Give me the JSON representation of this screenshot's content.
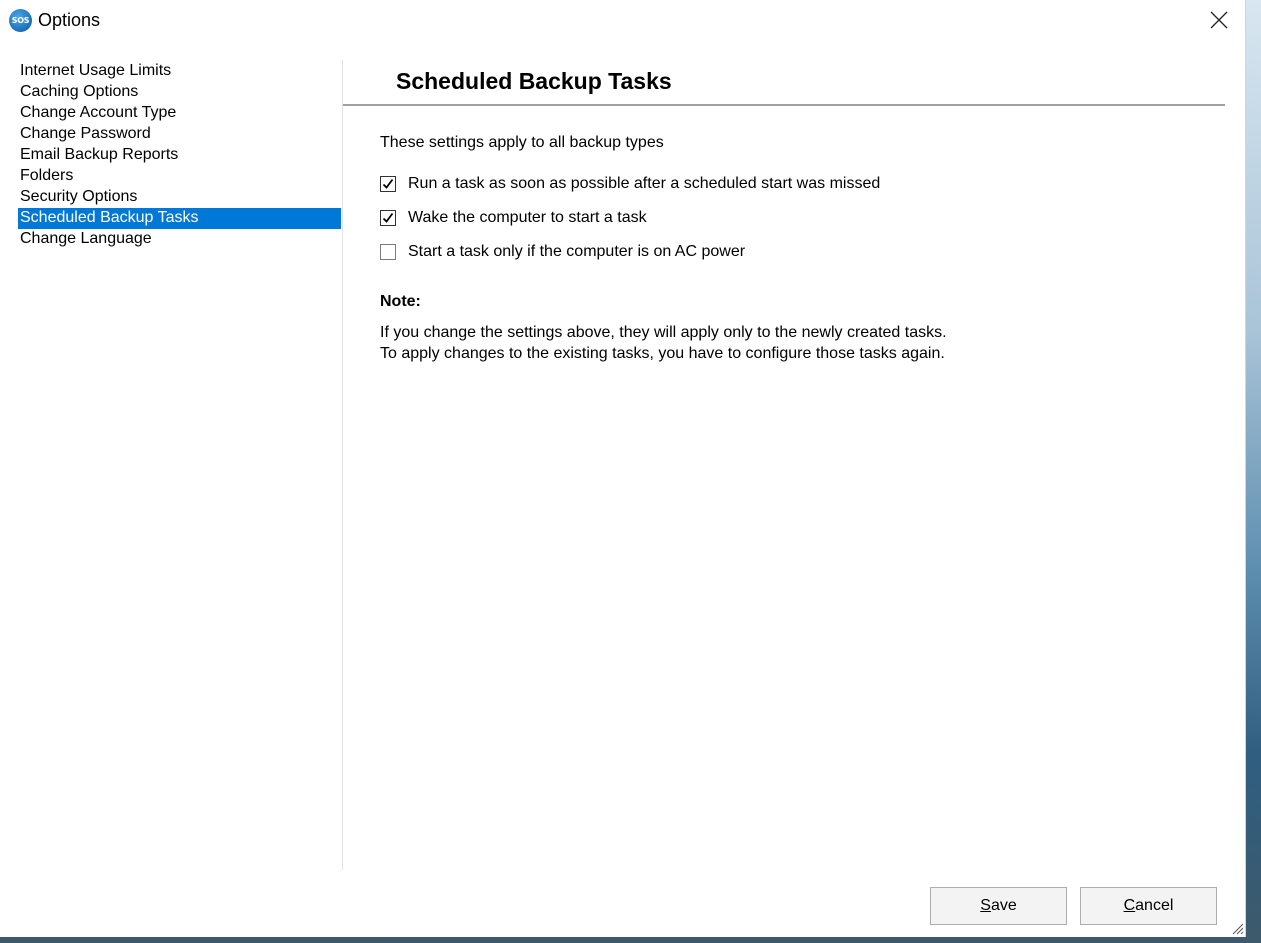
{
  "window": {
    "title": "Options",
    "app_icon_text": "SOS"
  },
  "sidebar": {
    "items": [
      {
        "label": "Internet Usage Limits",
        "selected": false
      },
      {
        "label": "Caching Options",
        "selected": false
      },
      {
        "label": "Change Account Type",
        "selected": false
      },
      {
        "label": "Change Password",
        "selected": false
      },
      {
        "label": "Email Backup Reports",
        "selected": false
      },
      {
        "label": "Folders",
        "selected": false
      },
      {
        "label": "Security Options",
        "selected": false
      },
      {
        "label": "Scheduled Backup Tasks",
        "selected": true
      },
      {
        "label": "Change Language",
        "selected": false
      }
    ]
  },
  "main": {
    "title": "Scheduled Backup Tasks",
    "intro": "These settings apply to all backup types",
    "options": [
      {
        "label": "Run a task as soon as possible after a scheduled start was missed",
        "checked": true
      },
      {
        "label": "Wake the computer to start a task",
        "checked": true
      },
      {
        "label": "Start a task only if the computer is on AC power",
        "checked": false
      }
    ],
    "note_title": "Note:",
    "note_lines": [
      "If you change the settings above, they will apply only to the newly created tasks.",
      "To apply changes to the existing tasks, you have to configure those tasks again."
    ]
  },
  "footer": {
    "save_mnemonic": "S",
    "save_rest": "ave",
    "cancel_mnemonic": "C",
    "cancel_rest": "ancel"
  },
  "colors": {
    "selection": "#0078d7"
  }
}
